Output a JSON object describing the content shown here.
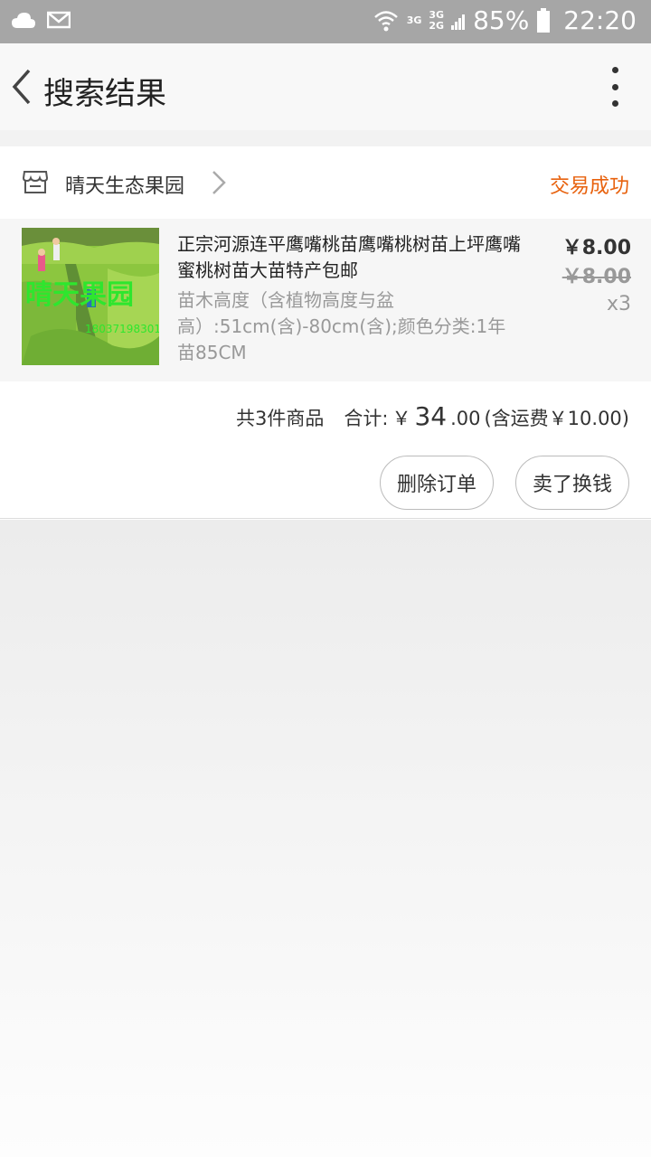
{
  "status_bar": {
    "icons": [
      "cloud-icon",
      "mail-icon",
      "wifi-icon",
      "signal-icon"
    ],
    "net_1": "3G",
    "net_2_top": "3G",
    "net_2_bottom": "2G",
    "battery_percent": "85%",
    "time": "22:20"
  },
  "app_bar": {
    "title": "搜索结果"
  },
  "order": {
    "shop_name": "晴天生态果园",
    "status": "交易成功",
    "item": {
      "title": "正宗河源连平鹰嘴桃苗鹰嘴桃树苗上坪鹰嘴蜜桃树苗大苗特产包邮",
      "spec": "苗木高度（含植物高度与盆高）:51cm(含)-80cm(含);颜色分类:1年苗85CM",
      "price": "￥8.00",
      "original_price": "￥8.00",
      "quantity": "x3",
      "thumbnail_watermark": "晴天果园",
      "thumbnail_phone": "18037198301"
    },
    "summary": {
      "count_text": "共3件商品",
      "total_label": "合计:",
      "currency": "￥",
      "total_int": "34",
      "total_dec": ".00",
      "shipping_note": "(含运费￥10.00)"
    },
    "buttons": {
      "delete": "删除订单",
      "sell": "卖了换钱"
    }
  },
  "colors": {
    "status_bar": "#a6a6a6",
    "accent_status": "#e8620e"
  }
}
